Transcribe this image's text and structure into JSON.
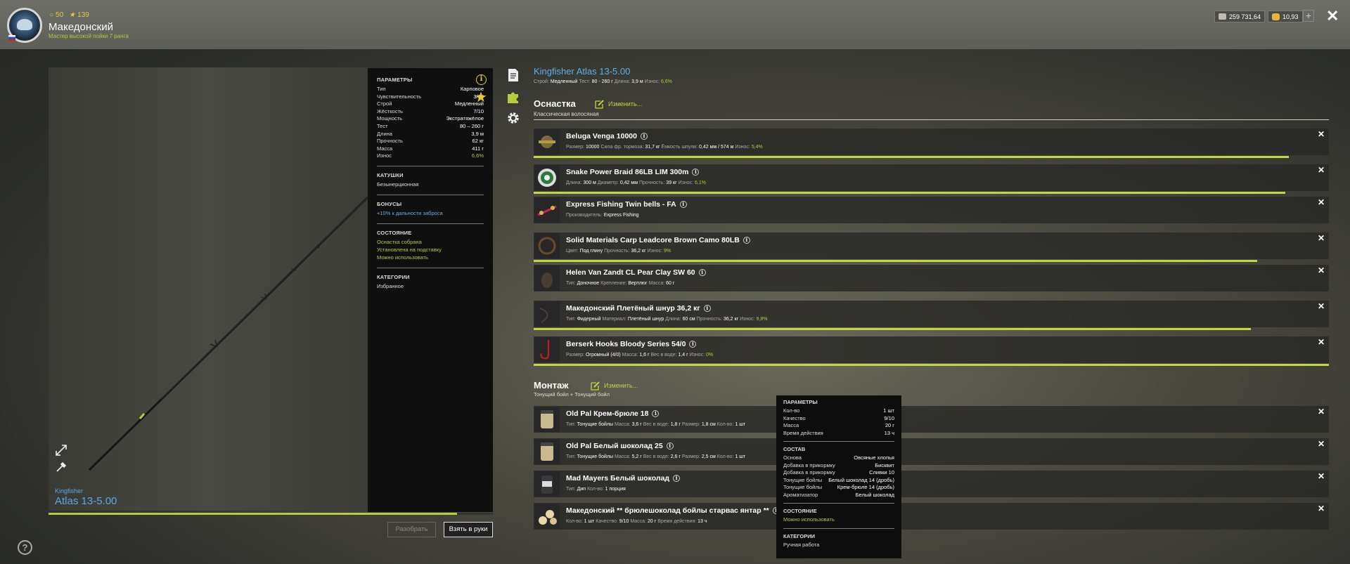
{
  "player": {
    "level": "50",
    "rank_level": "139",
    "name": "Македонский",
    "title": "Мастер высокой пойки 7 ранга"
  },
  "currency": {
    "silver": "259 731,64",
    "gold": "10,93"
  },
  "rod": {
    "brand": "Kingfisher",
    "model": "Atlas 13-5.00",
    "full_name": "Kingfisher Atlas 13-5.00",
    "progress_fraction": 0.92,
    "meta": [
      {
        "k": "Строй:",
        "v": "Медленный"
      },
      {
        "k": "Тест:",
        "v": "80 - 260 г"
      },
      {
        "k": "Длина:",
        "v": "3,9 м"
      },
      {
        "k": "Износ:",
        "v": "6,6%"
      }
    ]
  },
  "params": {
    "header": "ПАРАМЕТРЫ",
    "rows": [
      {
        "k": "Тип",
        "v": "Карповое"
      },
      {
        "k": "Чувствительность",
        "v": "3/10"
      },
      {
        "k": "Строй",
        "v": "Медленный"
      },
      {
        "k": "Жёсткость",
        "v": "7/10"
      },
      {
        "k": "Мощность",
        "v": "Экстратяжёлое"
      },
      {
        "k": "Тест",
        "v": "80 – 260 г"
      },
      {
        "k": "Длина",
        "v": "3,9 м"
      },
      {
        "k": "Прочность",
        "v": "62 кг"
      },
      {
        "k": "Масса",
        "v": "411 г"
      },
      {
        "k": "Износ",
        "v": "6,6%"
      }
    ],
    "reels_header": "КАТУШКИ",
    "reels_value": "Безынерционная",
    "bonus_header": "БОНУСЫ",
    "bonus_value": "+10% к дальности заброса",
    "state_header": "СОСТОЯНИЕ",
    "state": [
      "Оснастка собрана",
      "Установлена на подставку",
      "Можно использовать"
    ],
    "cat_header": "КАТЕГОРИИ",
    "cat_value": "Избранное"
  },
  "buttons": {
    "disassemble": "Разобрать",
    "take": "Взять в руки"
  },
  "rig": {
    "title": "Оснастка",
    "edit": "Изменить...",
    "subtitle": "Классическая волосяная",
    "items": [
      {
        "name": "Beluga Venga 10000",
        "meta": [
          [
            "Размер:",
            "10000"
          ],
          [
            "Сила фр. тормоза:",
            "31,7 кг"
          ],
          [
            "Ёмкость шпули:",
            "0,42 мм / 574 м"
          ],
          [
            "Износ:",
            "5,4%",
            "g"
          ]
        ],
        "wear": 0.95
      },
      {
        "name": "Snake Power Braid 86LB LIM 300m",
        "meta": [
          [
            "Длина:",
            "300 м"
          ],
          [
            "Диаметр:",
            "0,42 мм"
          ],
          [
            "Прочность:",
            "39 кг"
          ],
          [
            "Износ:",
            "6,1%",
            "g"
          ]
        ],
        "wear": 0.945
      },
      {
        "name": "Express Fishing Twin bells - FA",
        "meta": [
          [
            "Производитель:",
            "Express Fishing"
          ]
        ],
        "wear": 0
      },
      {
        "name": "Solid Materials Carp Leadcore Brown Camo 80LB",
        "meta": [
          [
            "Цвет:",
            "Под глину"
          ],
          [
            "Прочность:",
            "36,2 кг"
          ],
          [
            "Износ:",
            "9%",
            "g"
          ]
        ],
        "wear": 0.91
      },
      {
        "name": "Helen Van Zandt CL Pear Clay SW 60",
        "meta": [
          [
            "Тип:",
            "Доночное"
          ],
          [
            "Крепление:",
            "Вертлюг"
          ],
          [
            "Масса:",
            "60 г"
          ]
        ],
        "wear": 0
      },
      {
        "name": "Македонский Плетёный шнур 36,2 кг",
        "meta": [
          [
            "Тип:",
            "Фидерный"
          ],
          [
            "Материал:",
            "Плетёный шнур"
          ],
          [
            "Длина:",
            "60 см"
          ],
          [
            "Прочность:",
            "36,2 кг"
          ],
          [
            "Износ:",
            "9,8%",
            "g"
          ]
        ],
        "wear": 0.902
      },
      {
        "name": "Berserk Hooks Bloody Series 54/0",
        "meta": [
          [
            "Размер:",
            "Огромный (4/0)"
          ],
          [
            "Масса:",
            "1,6 г"
          ],
          [
            "Вес в воде:",
            "1,4 г"
          ],
          [
            "Износ:",
            "0%",
            "g"
          ]
        ],
        "wear": 1.0
      }
    ]
  },
  "mount": {
    "title": "Монтаж",
    "edit": "Изменить...",
    "subtitle": "Тонущий бойл  +  Тонущий бойл",
    "items": [
      {
        "name": "Old Pal Крем-брюле 18",
        "meta": [
          [
            "Тип:",
            "Тонущие бойлы"
          ],
          [
            "Масса:",
            "3,6 г"
          ],
          [
            "Вес в воде:",
            "1,8 г"
          ],
          [
            "Размер:",
            "1,8 см"
          ],
          [
            "Кол-во:",
            "1 шт"
          ]
        ]
      },
      {
        "name": "Old Pal Белый шоколад 25",
        "meta": [
          [
            "Тип:",
            "Тонущие бойлы"
          ],
          [
            "Масса:",
            "5,2 г"
          ],
          [
            "Вес в воде:",
            "2,6 г"
          ],
          [
            "Размер:",
            "2,5 см"
          ],
          [
            "Кол-во:",
            "1 шт"
          ]
        ]
      },
      {
        "name": "Mad Mayers Белый шоколад",
        "meta": [
          [
            "Тип:",
            "Дип"
          ],
          [
            "Кол-во:",
            "1 порция"
          ]
        ]
      },
      {
        "name": "Македонский ** брюлешоколад бойлы старвас янтар **",
        "meta": [
          [
            "Кол-во:",
            "1 шт"
          ],
          [
            "Качество:",
            "9/10"
          ],
          [
            "Масса:",
            "20 г"
          ],
          [
            "Время действия:",
            "13 ч"
          ]
        ]
      }
    ]
  },
  "tooltip": {
    "header": "ПАРАМЕТРЫ",
    "rows": [
      {
        "k": "Кол-во",
        "v": "1 шт"
      },
      {
        "k": "Качество",
        "v": "9/10"
      },
      {
        "k": "Масса",
        "v": "20 г"
      },
      {
        "k": "Время действия",
        "v": "13 ч"
      }
    ],
    "comp_header": "СОСТАВ",
    "comp": [
      {
        "k": "Основа",
        "v": "Овсяные хлопья"
      },
      {
        "k": "Добавка в прикормку",
        "v": "Бисквит"
      },
      {
        "k": "Добавка в прикормку",
        "v": "Сливки 10"
      },
      {
        "k": "Тонущие бойлы",
        "v": "Белый шоколад 14 (дробь)"
      },
      {
        "k": "Тонущие бойлы",
        "v": "Крем-брюле 14 (дробь)"
      },
      {
        "k": "Ароматизатор",
        "v": "Белый шоколад"
      }
    ],
    "state_header": "СОСТОЯНИЕ",
    "state_value": "Можно использовать",
    "cat_header": "КАТЕГОРИИ",
    "cat_value": "Ручная работа"
  },
  "colors": {
    "accent": "#b5cc3e",
    "title_blue": "#5eaee8",
    "star": "#e5c739"
  },
  "icons": [
    "info-icon",
    "star-icon",
    "document-icon",
    "puzzle-icon",
    "gear-icon",
    "expand-icon",
    "brush-icon",
    "help-icon",
    "close-icon",
    "edit-icon",
    "coin-icon"
  ]
}
